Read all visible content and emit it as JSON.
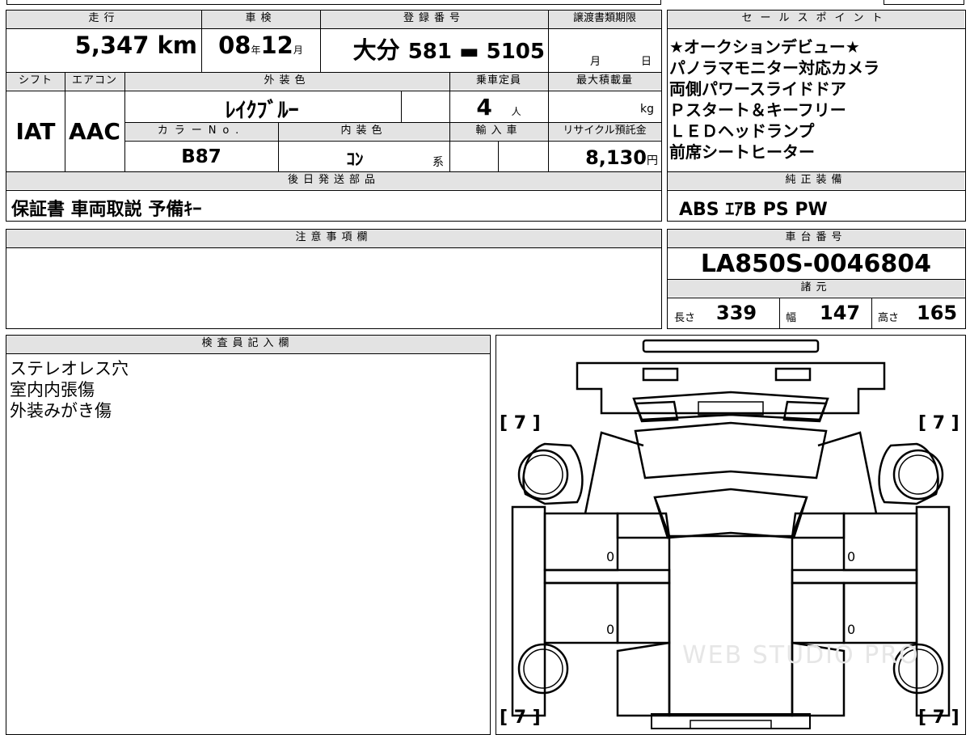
{
  "main": {
    "h_mileage": "走行",
    "h_inspection": "車検",
    "h_plate": "登録番号",
    "h_transfer": "譲渡書類期限",
    "mileage": "5,347 km",
    "insp_year": "08",
    "insp_year_unit": "年",
    "insp_month": "12",
    "insp_month_unit": "月",
    "plate_region": "大分",
    "plate_number": "581 ▬ 5105",
    "transfer_month": "月",
    "transfer_day": "日",
    "h_shift": "シフト",
    "h_ac": "エアコン",
    "h_ext_color": "外装色",
    "h_capacity": "乗車定員",
    "h_max_load": "最大積載量",
    "shift": "IAT",
    "ac": "AAC",
    "ext_color": "ﾚｲｸﾌﾞﾙｰ",
    "capacity": "4",
    "capacity_unit": "人",
    "load_unit": "kg",
    "h_color_no": "カラーNo.",
    "h_int_color": "内装色",
    "h_import": "輸入車",
    "h_recycle": "リサイクル預託金",
    "color_no": "B87",
    "int_color": "ｺﾝ",
    "int_color_suffix": "系",
    "recycle": "8,130",
    "recycle_unit": "円",
    "h_later_parts": "後日発送部品",
    "later_parts": "保証書 車両取説 予備ｷｰ"
  },
  "sales": {
    "header": "セールスポイント",
    "points": [
      "★オークションデビュー★",
      "パノラマモニター対応カメラ",
      "両側パワースライドドア",
      "Ｐスタート＆キーフリー",
      "ＬＥＤヘッドランプ",
      "前席シートヒーター"
    ]
  },
  "equipment": {
    "header": "純正装備",
    "value": "ABS ｴｱB PS PW"
  },
  "notes": {
    "header": "注意事項欄"
  },
  "chassis": {
    "header": "車台番号",
    "value": "LA850S-0046804"
  },
  "specs": {
    "header": "諸元",
    "length_label": "長さ",
    "length": "339",
    "width_label": "幅",
    "width": "147",
    "height_label": "高さ",
    "height": "165"
  },
  "inspector": {
    "header": "検査員記入欄",
    "lines": [
      "ステレオレス穴",
      "室内内張傷",
      "外装みがき傷"
    ]
  },
  "diagram": {
    "tl": "[ 7 ]",
    "tr": "[ 7 ]",
    "bl": "[ 7 ]",
    "br": "[ 7 ]",
    "d1": "0",
    "d2": "0",
    "d3": "0",
    "d4": "0",
    "watermark": "WEB STUDIO PRO"
  }
}
